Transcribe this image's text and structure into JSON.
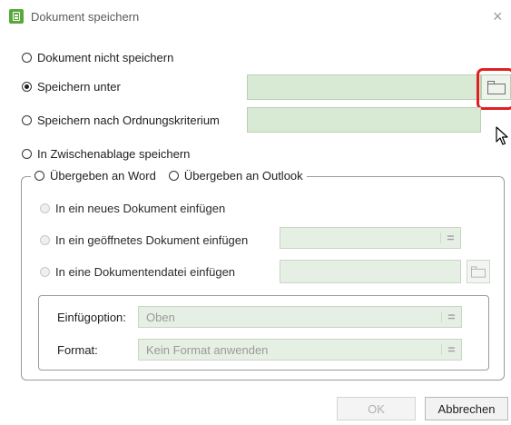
{
  "window": {
    "title": "Dokument speichern",
    "close_glyph": "×",
    "icon": "document-icon"
  },
  "options": {
    "not_save": "Dokument nicht speichern",
    "save_as": "Speichern unter",
    "save_by_criterion": "Speichern nach Ordnungskriterium",
    "clipboard": "In Zwischenablage speichern"
  },
  "selected_option": "save_as",
  "save_as_path": "",
  "criterion_value": "",
  "transfer": {
    "word": "Übergeben an Word",
    "outlook": "Übergeben an Outlook",
    "new_doc": "In ein neues Dokument einfügen",
    "open_doc": "In ein geöffnetes Dokument einfügen",
    "doc_file": "In eine Dokumentendatei einfügen"
  },
  "insert_option": {
    "label": "Einfügoption:",
    "value": "Oben"
  },
  "format": {
    "label": "Format:",
    "value": "Kein Format anwenden"
  },
  "buttons": {
    "ok": "OK",
    "cancel": "Abbrechen"
  },
  "colors": {
    "field_bg": "#d8ead4",
    "highlight": "#e02020",
    "app_icon": "#5aa83a"
  }
}
